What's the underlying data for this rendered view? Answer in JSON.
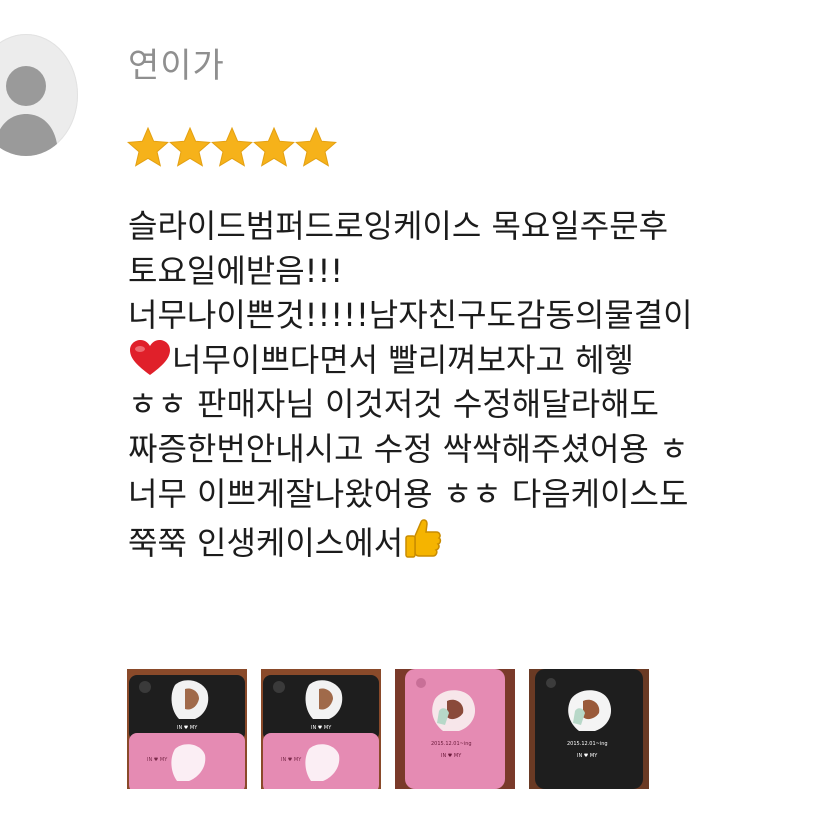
{
  "review": {
    "author": "연이가",
    "rating": 5,
    "rating_max": 5,
    "text_lines": [
      "슬라이드범퍼드로잉케이스 목요일주문후",
      "토요일에받음!!!",
      "너무나이쁜것!!!!!남자친구도감동의물결이",
      "너무이쁘다면서 빨리껴보자고 헤헿",
      "ㅎㅎ 판매자님 이것저것 수정해달라해도",
      "짜증한번안내시고 수정 싹싹해주셨어용 ㅎ",
      "너무 이쁘게잘나왔어용 ㅎㅎ 다음케이스도",
      "쭉쭉 인생케이스에서"
    ],
    "emojis": {
      "heart": "red-heart-emoji",
      "thumbs_up": "thumbs-up-emoji"
    },
    "photos": [
      {
        "name": "black-and-pink-cases"
      },
      {
        "name": "black-and-pink-cases"
      },
      {
        "name": "pink-case"
      },
      {
        "name": "black-case"
      }
    ]
  },
  "colors": {
    "star": "#f6b21a",
    "author": "#8f8f8f",
    "text": "#1c1c1c",
    "heart": "#e0202a",
    "pink_case": "#e58bb3",
    "black_case": "#1e1e1e"
  }
}
